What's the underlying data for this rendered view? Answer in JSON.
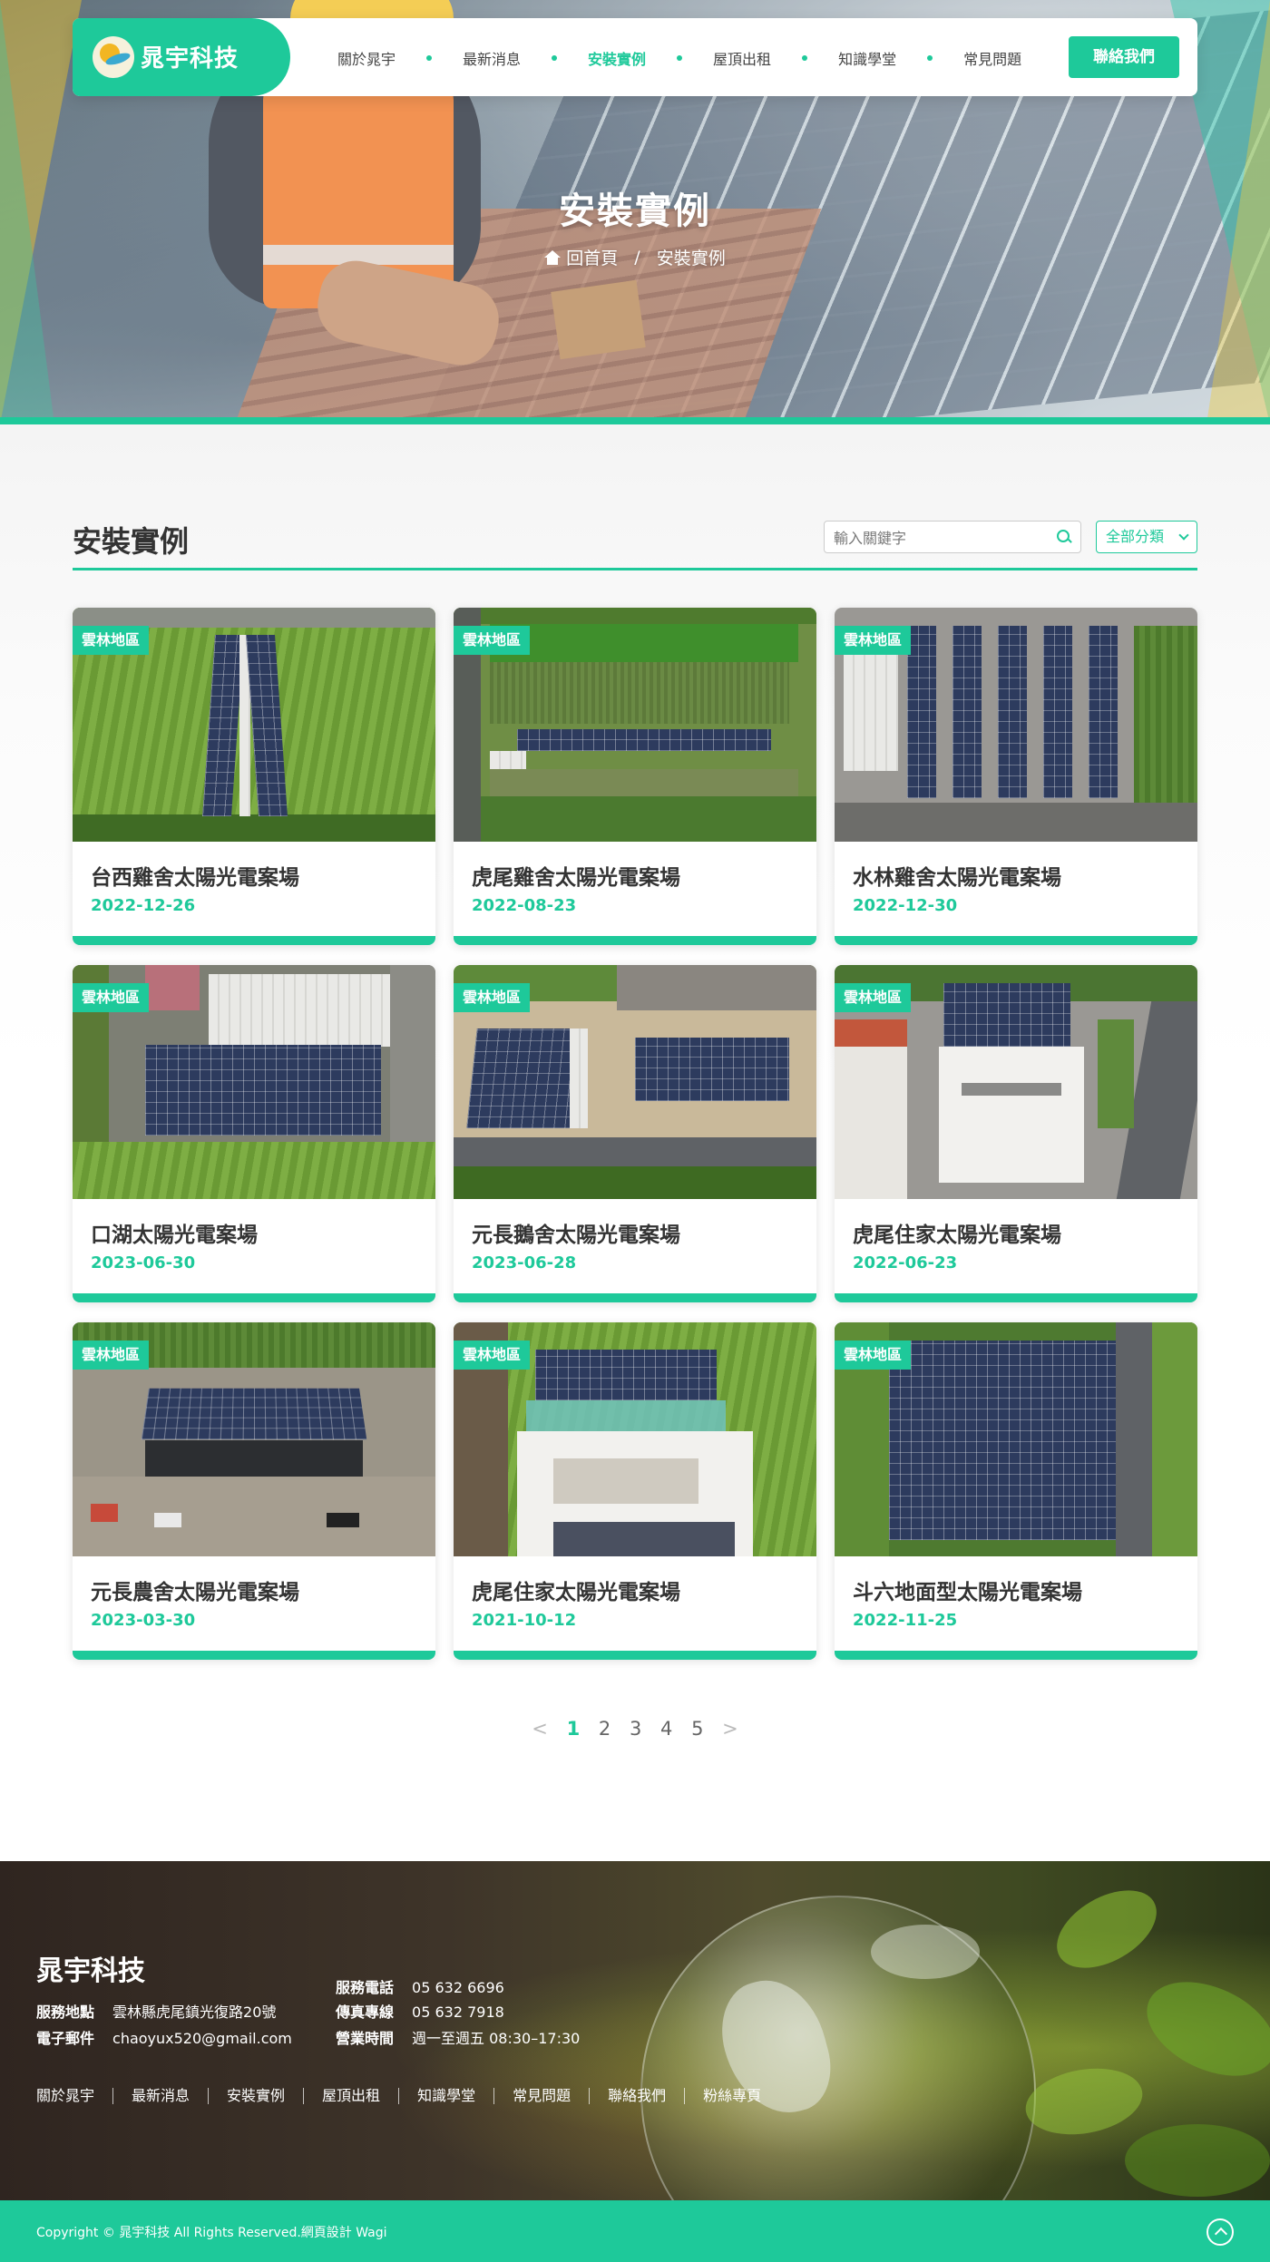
{
  "brand": {
    "name": "晁宇科技",
    "accent": "#1ec99a"
  },
  "nav": {
    "items": [
      {
        "label": "關於晁宇",
        "active": false
      },
      {
        "label": "最新消息",
        "active": false
      },
      {
        "label": "安裝實例",
        "active": true
      },
      {
        "label": "屋頂出租",
        "active": false
      },
      {
        "label": "知識學堂",
        "active": false
      },
      {
        "label": "常見問題",
        "active": false
      }
    ],
    "contact_label": "聯絡我們"
  },
  "hero": {
    "title": "安裝實例",
    "breadcrumb_home": "回首頁",
    "breadcrumb_sep": "/",
    "breadcrumb_current": "安裝實例"
  },
  "section": {
    "title": "安裝實例",
    "search_placeholder": "輸入關鍵字",
    "category_label": "全部分類"
  },
  "cards": [
    {
      "tag": "雲林地區",
      "title": "台西雞舍太陽光電案場",
      "date": "2022-12-26"
    },
    {
      "tag": "雲林地區",
      "title": "虎尾雞舍太陽光電案場",
      "date": "2022-08-23"
    },
    {
      "tag": "雲林地區",
      "title": "水林雞舍太陽光電案場",
      "date": "2022-12-30"
    },
    {
      "tag": "雲林地區",
      "title": "口湖太陽光電案場",
      "date": "2023-06-30"
    },
    {
      "tag": "雲林地區",
      "title": "元長鵝舍太陽光電案場",
      "date": "2023-06-28"
    },
    {
      "tag": "雲林地區",
      "title": "虎尾住家太陽光電案場",
      "date": "2022-06-23"
    },
    {
      "tag": "雲林地區",
      "title": "元長農舍太陽光電案場",
      "date": "2023-03-30"
    },
    {
      "tag": "雲林地區",
      "title": "虎尾住家太陽光電案場",
      "date": "2021-10-12"
    },
    {
      "tag": "雲林地區",
      "title": "斗六地面型太陽光電案場",
      "date": "2022-11-25"
    }
  ],
  "pagination": {
    "prev": "<",
    "pages": [
      "1",
      "2",
      "3",
      "4",
      "5"
    ],
    "current": "1",
    "next": ">"
  },
  "footer": {
    "brand": "晁宇科技",
    "address_label": "服務地點",
    "address": "雲林縣虎尾鎮光復路20號",
    "email_label": "電子郵件",
    "email": "chaoyux520@gmail.com",
    "phone_label": "服務電話",
    "phone": "05 632 6696",
    "fax_label": "傳真專線",
    "fax": "05 632 7918",
    "hours_label": "營業時間",
    "hours": "週一至週五 08:30–17:30",
    "links": [
      "關於晁宇",
      "最新消息",
      "安裝實例",
      "屋頂出租",
      "知識學堂",
      "常見問題",
      "聯絡我們",
      "粉絲專頁"
    ],
    "copyright": "Copyright © 晁宇科技 All Rights Reserved.網頁設計 Wagi"
  }
}
